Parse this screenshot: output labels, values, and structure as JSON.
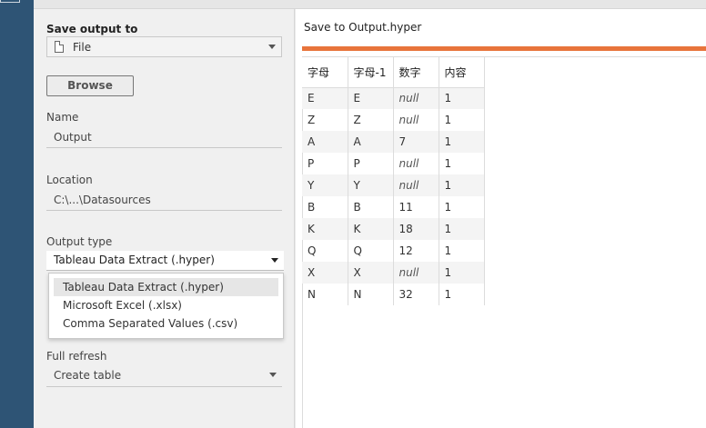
{
  "left_panel": {
    "save_output_label": "Save output to",
    "save_output_value": "File",
    "browse_label": "Browse",
    "name_label": "Name",
    "name_value": "Output",
    "location_label": "Location",
    "location_value": "C:\\...\\Datasources",
    "output_type_label": "Output type",
    "output_type_value": "Tableau Data Extract (.hyper)",
    "output_type_options": [
      "Tableau Data Extract (.hyper)",
      "Microsoft Excel (.xlsx)",
      "Comma Separated Values (.csv)"
    ],
    "full_refresh_label": "Full refresh",
    "full_refresh_value": "Create table"
  },
  "right_panel": {
    "title": "Save to Output.hyper",
    "accent_color": "#e8743b",
    "columns": [
      "字母",
      "字母-1",
      "数字",
      "内容"
    ],
    "rows": [
      [
        "E",
        "E",
        "null",
        "1"
      ],
      [
        "Z",
        "Z",
        "null",
        "1"
      ],
      [
        "A",
        "A",
        "7",
        "1"
      ],
      [
        "P",
        "P",
        "null",
        "1"
      ],
      [
        "Y",
        "Y",
        "null",
        "1"
      ],
      [
        "B",
        "B",
        "11",
        "1"
      ],
      [
        "K",
        "K",
        "18",
        "1"
      ],
      [
        "Q",
        "Q",
        "12",
        "1"
      ],
      [
        "X",
        "X",
        "null",
        "1"
      ],
      [
        "N",
        "N",
        "32",
        "1"
      ]
    ]
  },
  "icons": {
    "file": "file-icon",
    "dropdown": "chevron-down-icon"
  }
}
